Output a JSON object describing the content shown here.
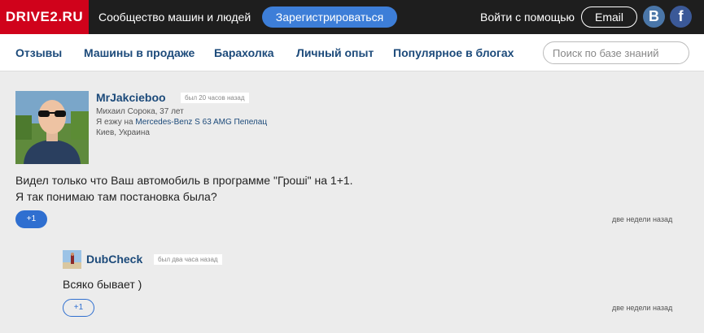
{
  "header": {
    "logo": "DRIVE2.RU",
    "tagline": "Сообщество машин и людей",
    "register_label": "Зарегистрироваться",
    "login_with": "Войти с помощью",
    "email_label": "Email",
    "vk_glyph": "B",
    "fb_glyph": "f"
  },
  "nav": {
    "items": [
      "Отзывы",
      "Машины в продаже",
      "Барахолка",
      "Личный опыт",
      "Популярное в блогах"
    ],
    "search_placeholder": "Поиск по базе знаний"
  },
  "post": {
    "username": "MrJakcieboo",
    "seen": "был 20 часов назад",
    "real_name": "Михаил Сорока, 37 лет",
    "drives_prefix": "Я езжу на ",
    "car": "Mercedes-Benz S 63 AMG Пепелац",
    "location": "Киев, Украина",
    "text_line1": "Видел только что Ваш автомобиль в программе \"Гроші\" на 1+1.",
    "text_line2": "Я так понимаю там постановка была?",
    "plus_label": "+1",
    "time_ago": "две недели назад"
  },
  "reply": {
    "username": "DubCheck",
    "seen": "был два часа назад",
    "text": "Всяко бывает )",
    "plus_label": "+1",
    "time_ago": "две недели назад"
  },
  "colors": {
    "brand_red": "#d0021b",
    "accent_blue": "#3d7ed8",
    "link_blue": "#1c4a7a"
  }
}
